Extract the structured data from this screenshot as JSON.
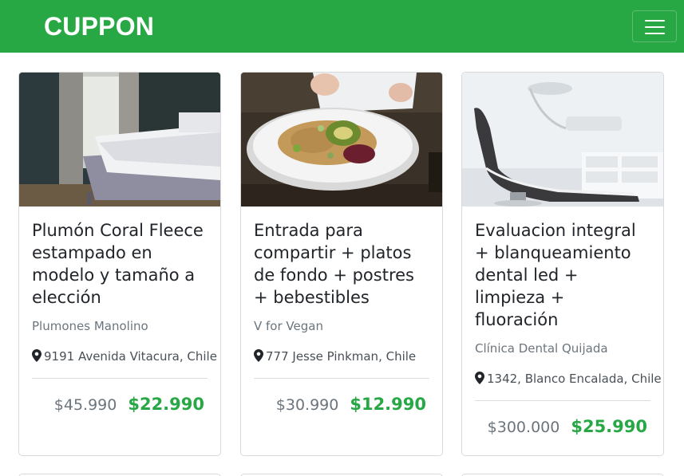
{
  "navbar": {
    "brand": "CUPPON",
    "brand_color": "#28a745",
    "toggler_icon": "hamburger-icon"
  },
  "cards": [
    {
      "title": "Plumón Coral Fleece estampado en modelo y tamaño a elección",
      "merchant": "Plumones Manolino",
      "location": "9191 Avenida Vitacura, Chile",
      "old_price": "$45.990",
      "new_price": "$22.990",
      "image": "bedroom-photo"
    },
    {
      "title": "Entrada para compartir + platos de fondo + postres + bebestibles",
      "merchant": "V for Vegan",
      "location": "777 Jesse Pinkman, Chile",
      "old_price": "$30.990",
      "new_price": "$12.990",
      "image": "vegan-food-photo"
    },
    {
      "title": "Evaluacion integral + blanqueamiento dental led + limpieza + fluoración",
      "merchant": "Clínica Dental Quijada",
      "location": "1342, Blanco Encalada, Chile",
      "old_price": "$300.000",
      "new_price": "$25.990",
      "image": "dental-clinic-photo"
    }
  ],
  "colors": {
    "accent": "#28a745",
    "muted_text": "#6c757d"
  }
}
